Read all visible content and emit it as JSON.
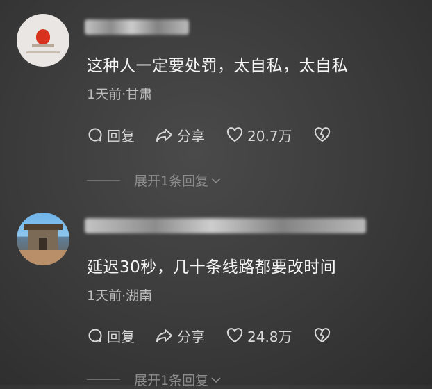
{
  "comments": [
    {
      "text": "这种人一定要处罚，太自私，太自私",
      "meta": "1天前·甘肃",
      "reply_label": "回复",
      "share_label": "分享",
      "like_count": "20.7万",
      "expand_label": "展开1条回复"
    },
    {
      "text": "延迟30秒，几十条线路都要改时间",
      "meta": "1天前·湖南",
      "reply_label": "回复",
      "share_label": "分享",
      "like_count": "24.8万",
      "expand_label": "展开1条回复"
    }
  ],
  "icons": {
    "reply": "comment-bubble-icon",
    "share": "share-arrow-icon",
    "like": "heart-icon",
    "dislike": "broken-heart-icon",
    "expand": "chevron-down-icon"
  }
}
